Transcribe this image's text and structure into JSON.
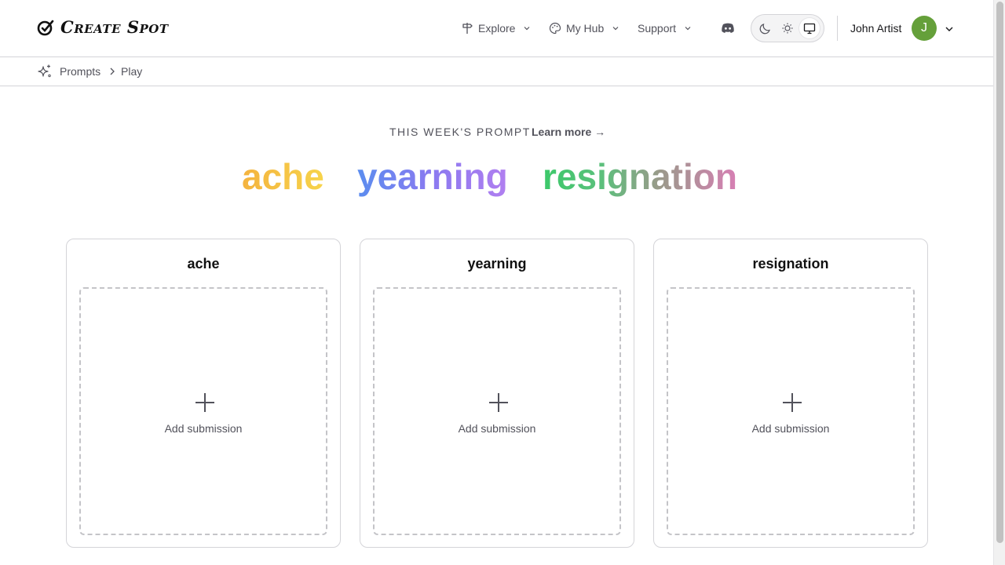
{
  "header": {
    "logo_text": "Create Spot",
    "nav": [
      {
        "label": "Explore",
        "icon": "signpost-icon"
      },
      {
        "label": "My Hub",
        "icon": "palette-icon"
      },
      {
        "label": "Support"
      }
    ],
    "discord_icon": "discord-icon",
    "theme": {
      "options": [
        "dark",
        "light",
        "system"
      ],
      "selected": "system"
    },
    "user": {
      "name": "John Artist",
      "initial": "J",
      "avatar_color": "#65a03a"
    }
  },
  "breadcrumb": {
    "icon": "sparkles-icon",
    "items": [
      "Prompts",
      "Play"
    ]
  },
  "prompt": {
    "label": "THIS WEEK'S PROMPT",
    "learn_more": "Learn more →",
    "words": [
      "ache",
      "yearning",
      "resignation"
    ]
  },
  "cards": [
    {
      "title": "ache",
      "action": "Add submission"
    },
    {
      "title": "yearning",
      "action": "Add submission"
    },
    {
      "title": "resignation",
      "action": "Add submission"
    }
  ]
}
